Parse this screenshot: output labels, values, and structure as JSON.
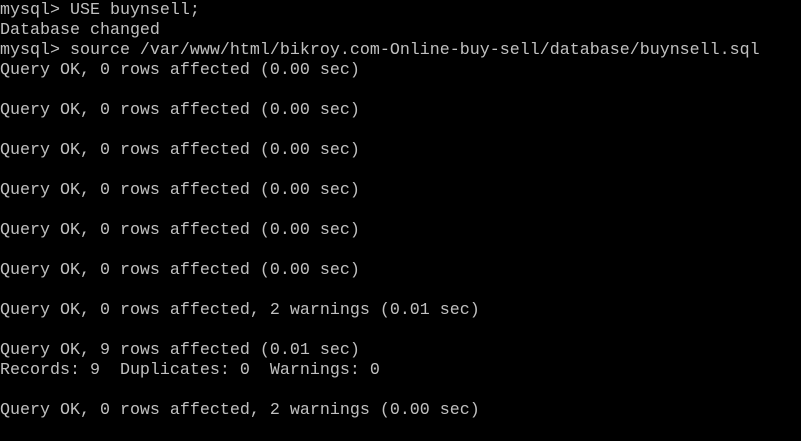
{
  "terminal": {
    "lines": [
      "mysql> USE buynsell;",
      "Database changed",
      "mysql> source /var/www/html/bikroy.com-Online-buy-sell/database/buynsell.sql",
      "Query OK, 0 rows affected (0.00 sec)",
      "",
      "Query OK, 0 rows affected (0.00 sec)",
      "",
      "Query OK, 0 rows affected (0.00 sec)",
      "",
      "Query OK, 0 rows affected (0.00 sec)",
      "",
      "Query OK, 0 rows affected (0.00 sec)",
      "",
      "Query OK, 0 rows affected (0.00 sec)",
      "",
      "Query OK, 0 rows affected, 2 warnings (0.01 sec)",
      "",
      "Query OK, 9 rows affected (0.01 sec)",
      "Records: 9  Duplicates: 0  Warnings: 0",
      "",
      "Query OK, 0 rows affected, 2 warnings (0.00 sec)"
    ]
  }
}
